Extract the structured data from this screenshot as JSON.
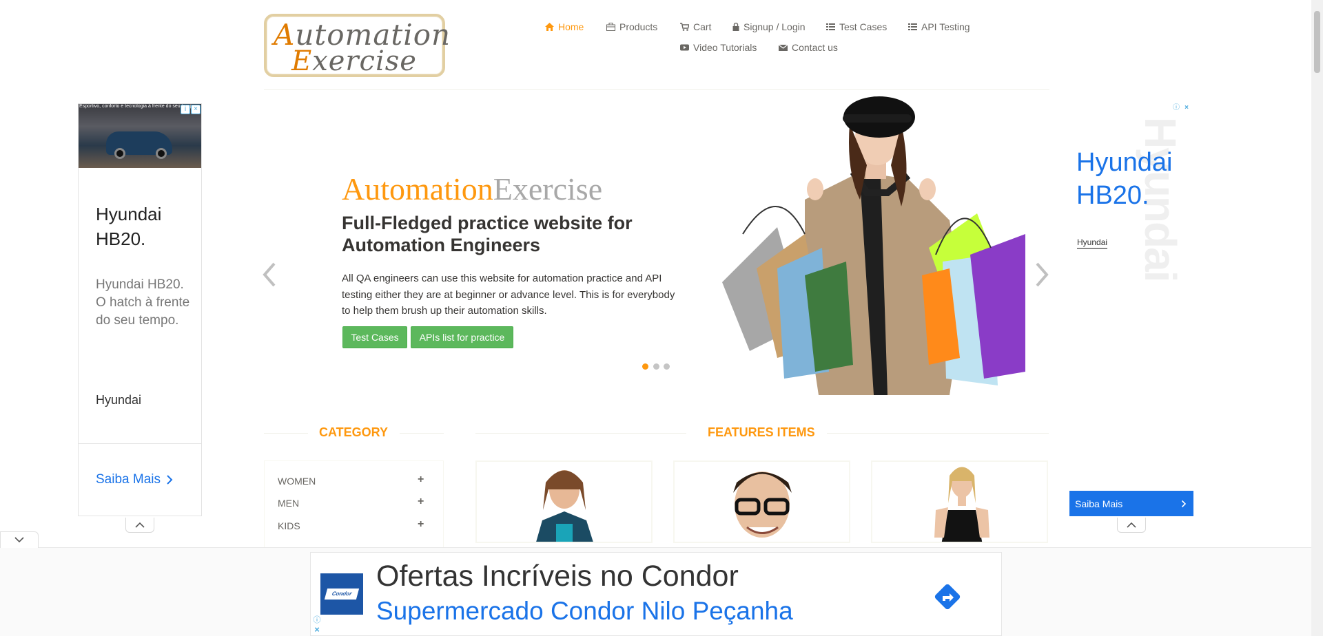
{
  "logo": {
    "line1_cap": "A",
    "line1_rest": "utomation",
    "line2_cap": "E",
    "line2_rest": "xercise"
  },
  "nav": {
    "home": "Home",
    "products": "Products",
    "cart": "Cart",
    "signup_login": "Signup / Login",
    "test_cases": "Test Cases",
    "api_testing": "API Testing",
    "video_tutorials": "Video Tutorials",
    "contact_us": "Contact us"
  },
  "ad_left": {
    "image_text": "Esportivo, conforto e tecnologia à frente do seu tempo.",
    "headline_1": "Hyundai",
    "headline_2": "HB20.",
    "body": "Hyundai HB20. O hatch à frente do seu tempo.",
    "brand": "Hyundai",
    "cta": "Saiba Mais"
  },
  "ad_right": {
    "headline_1": "Hyundai",
    "headline_2": "HB20.",
    "brand": "Hyundai",
    "cta": "Saiba Mais",
    "background_text": "Hyundai"
  },
  "slider": {
    "title_orange": "Automation",
    "title_gray": "Exercise",
    "heading": "Full-Fledged practice website for Automation Engineers",
    "description": "All QA engineers can use this website for automation practice and API testing either they are at beginner or advance level. This is for everybody to help them brush up their automation skills.",
    "btn_test_cases": "Test Cases",
    "btn_apis": "APIs list for practice",
    "active_slide": 1,
    "slide_count": 3
  },
  "sections": {
    "category": "CATEGORY",
    "features": "FEATURES ITEMS"
  },
  "categories": [
    {
      "label": "WOMEN",
      "toggle": "+"
    },
    {
      "label": "MEN",
      "toggle": "+"
    },
    {
      "label": "KIDS",
      "toggle": "+"
    }
  ],
  "bottom_ad": {
    "logo_text": "Condor",
    "headline": "Ofertas Incríveis no Condor",
    "subline": "Supermercado Condor Nilo Peçanha"
  },
  "colors": {
    "accent": "#fe980f",
    "green": "#5cb85c",
    "ad_blue": "#1a73e8",
    "text": "#696763",
    "dark_text": "#363432"
  }
}
